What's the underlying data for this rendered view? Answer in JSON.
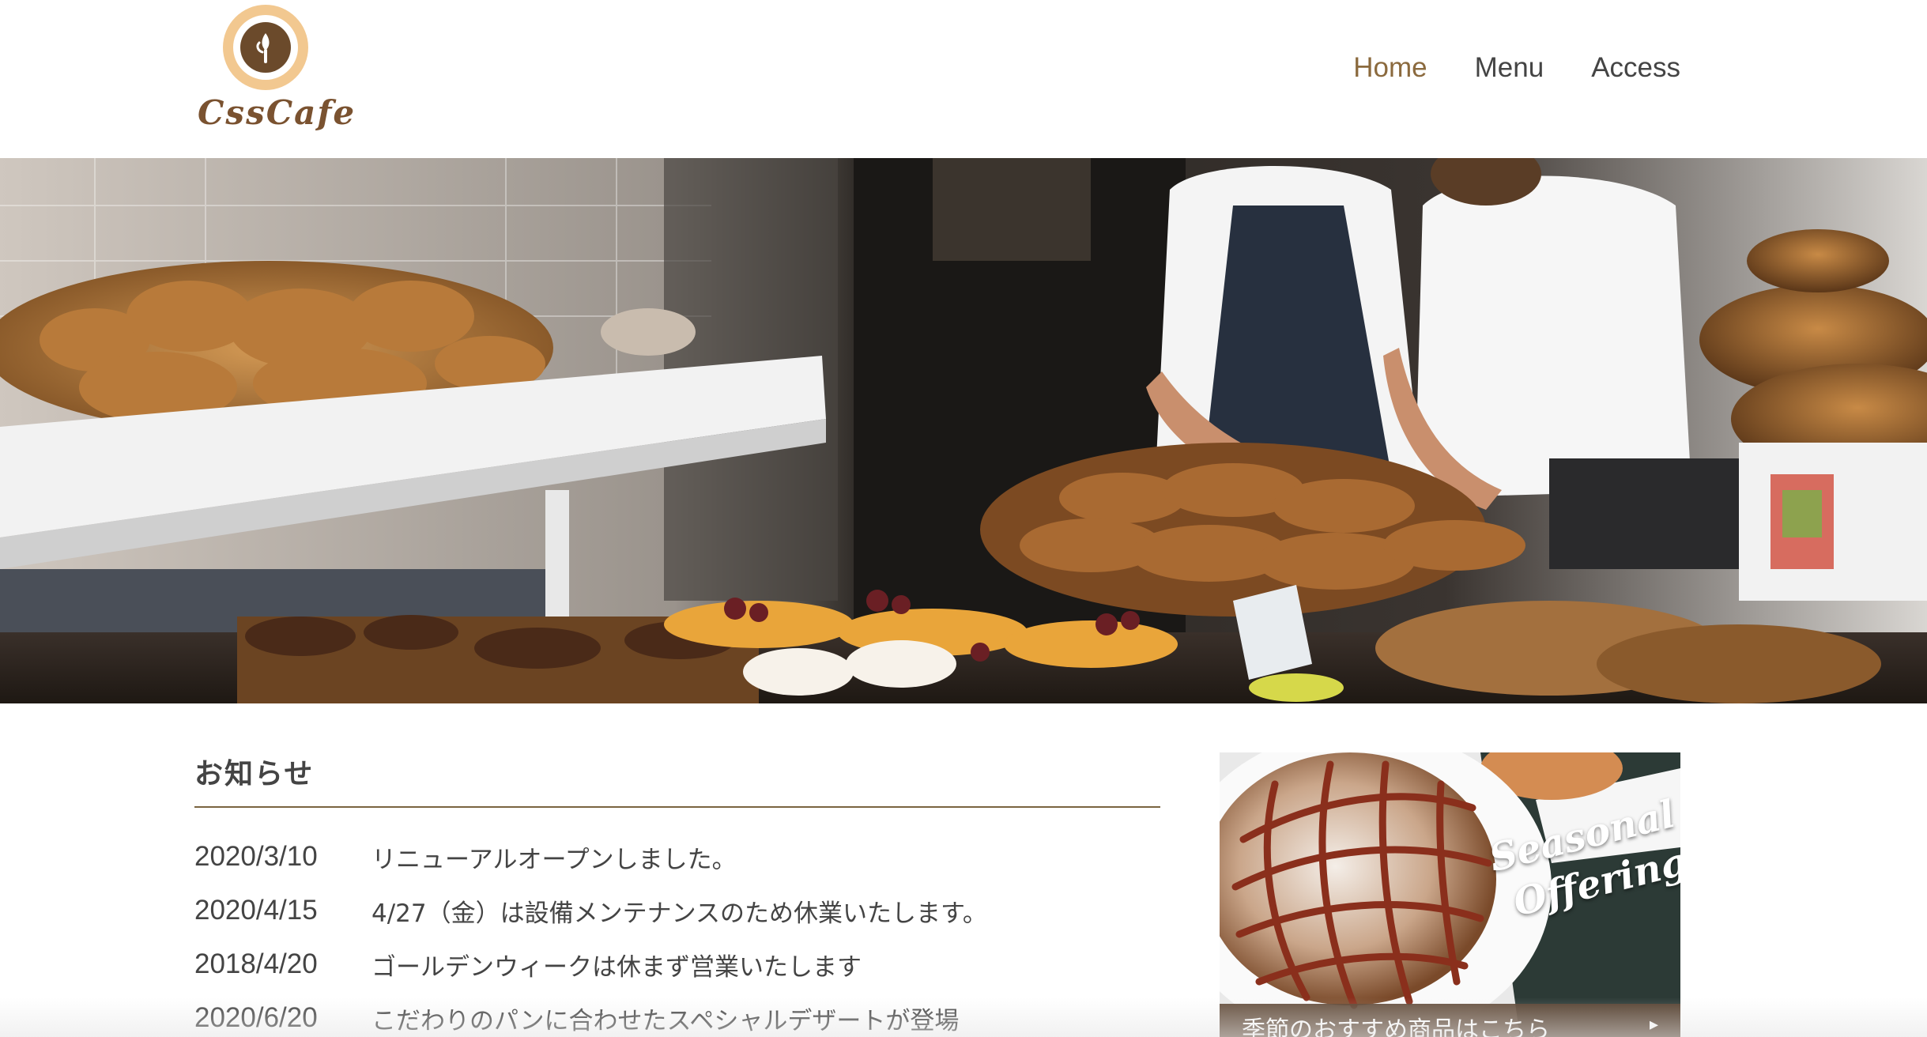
{
  "header": {
    "logo_text": "CssCafe",
    "nav": [
      {
        "label": "Home",
        "active": true
      },
      {
        "label": "Menu",
        "active": false
      },
      {
        "label": "Access",
        "active": false
      }
    ]
  },
  "hero": {
    "image": "bakery-counter-photo"
  },
  "news": {
    "title": "お知らせ",
    "items": [
      {
        "date": "2020/3/10",
        "text": "リニューアルオープンしました。"
      },
      {
        "date": "2020/4/15",
        "text": "4/27（金）は設備メンテナンスのため休業いたします。"
      },
      {
        "date": "2018/4/20",
        "text": "ゴールデンウィークは休まず営業いたします"
      },
      {
        "date": "2020/6/20",
        "text": "こだわりのパンに合わせたスペシャルデザートが登場"
      }
    ]
  },
  "banner": {
    "script_line1": "Seasonal",
    "script_line2": "Offering",
    "link_label": "季節のおすすめ商品はこちら",
    "arrow": "▸"
  },
  "colors": {
    "accent": "#8b6a3e",
    "logo_orange": "#f2c890",
    "logo_brown": "#6b4a2b",
    "banner_bar": "#5a4230"
  }
}
